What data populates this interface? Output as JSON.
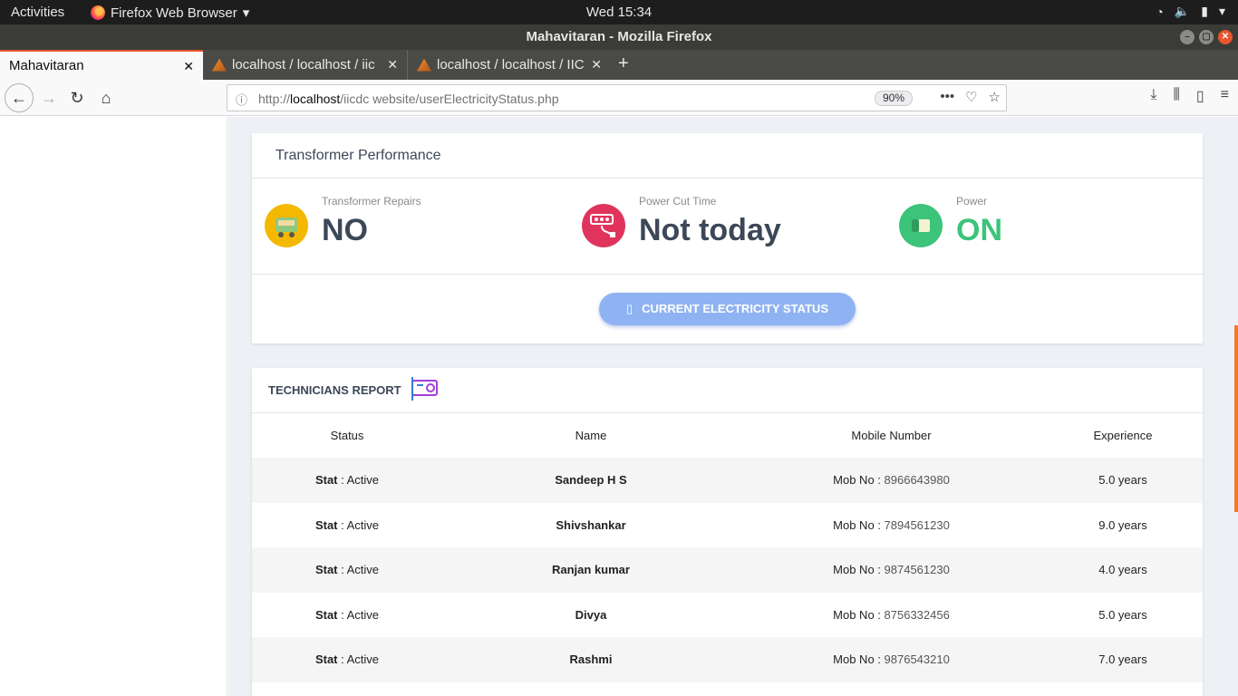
{
  "system_bar": {
    "activities": "Activities",
    "app_name": "Firefox Web Browser",
    "clock": "Wed 15:34"
  },
  "window": {
    "title": "Mahavitaran - Mozilla Firefox"
  },
  "tabs": [
    {
      "label": "Mahavitaran",
      "active": true
    },
    {
      "label": "localhost / localhost / iic",
      "active": false
    },
    {
      "label": "localhost / localhost / IIC",
      "active": false
    }
  ],
  "urlbar": {
    "prefix": "http://",
    "host": "localhost",
    "path": "/iicdc website/userElectricityStatus.php",
    "zoom": "90%"
  },
  "transformer": {
    "heading": "Transformer Performance",
    "repairs_label": "Transformer Repairs",
    "repairs_value": "NO",
    "powercut_label": "Power Cut Time",
    "powercut_value": "Not today",
    "power_label": "Power",
    "power_value": "ON",
    "button_label": "CURRENT ELECTRICITY STATUS"
  },
  "technicians": {
    "heading": "TECHNICIANS REPORT",
    "columns": [
      "Status",
      "Name",
      "Mobile Number",
      "Experience"
    ],
    "stat_prefix": "Stat",
    "mob_prefix": "Mob No",
    "rows": [
      {
        "status": "Active",
        "name": "Sandeep H S",
        "mobile": "8966643980",
        "experience": "5.0 years"
      },
      {
        "status": "Active",
        "name": "Shivshankar",
        "mobile": "7894561230",
        "experience": "9.0 years"
      },
      {
        "status": "Active",
        "name": "Ranjan kumar",
        "mobile": "9874561230",
        "experience": "4.0 years"
      },
      {
        "status": "Active",
        "name": "Divya",
        "mobile": "8756332456",
        "experience": "5.0 years"
      },
      {
        "status": "Active",
        "name": "Rashmi",
        "mobile": "9876543210",
        "experience": "7.0 years"
      }
    ]
  },
  "colors": {
    "repairs_icon": "#f5b800",
    "powercut_icon": "#e0345c",
    "power_icon": "#3bc47a",
    "power_value": "#3bc47a",
    "button": "#8fb3f2"
  }
}
